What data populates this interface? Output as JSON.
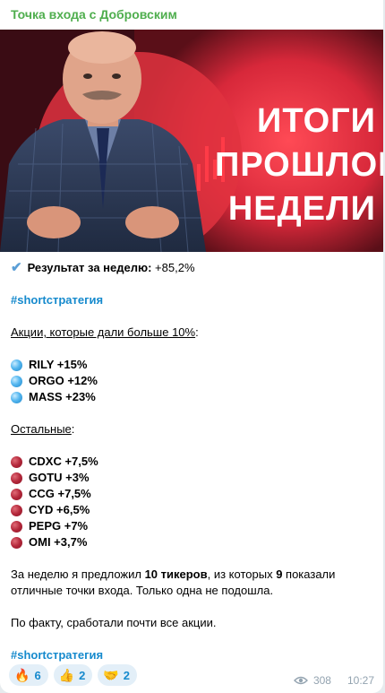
{
  "channel": {
    "name": "Точка входа с Добровским"
  },
  "cover": {
    "title_lines": [
      "ИТОГИ",
      "ПРОШЛОЙ",
      "НЕДЕЛИ"
    ]
  },
  "post": {
    "result_label": "Результат за неделю:",
    "result_value": "+85,2%",
    "hashtag": "#shortстратегия",
    "section_top": "Акции, которые дали больше 10%",
    "section_top_suffix": ":",
    "top_stocks": [
      "RILY +15%",
      "ORGO +12%",
      "MASS +23%"
    ],
    "section_rest": "Остальные",
    "section_rest_suffix": ":",
    "rest_stocks": [
      "CDXC +7,5%",
      "GOTU +3%",
      "CCG +7,5%",
      "CYD +6,5%",
      "PEPG +7%",
      "OMI +3,7%"
    ],
    "summary_1a": "За неделю я предложил ",
    "summary_1b": "10 тикеров",
    "summary_1c": ", из которых ",
    "summary_1d": "9",
    "summary_1e": " показали",
    "summary_2": "отличные точки входа. Только одна не подошла.",
    "summary_3": "По факту, сработали почти все акции.",
    "hashtag_bottom": "#shortстратегия"
  },
  "reactions": [
    {
      "emoji": "🔥",
      "icon": "fire-icon",
      "count": "6"
    },
    {
      "emoji": "👍",
      "icon": "thumbs-up-icon",
      "count": "2"
    },
    {
      "emoji": "🤝",
      "icon": "handshake-icon",
      "count": "2"
    }
  ],
  "meta": {
    "views": "308",
    "time": "10:27"
  },
  "colors": {
    "channel_name": "#4fae4e",
    "hashtag": "#168acd",
    "cover_red": "#e53340"
  }
}
